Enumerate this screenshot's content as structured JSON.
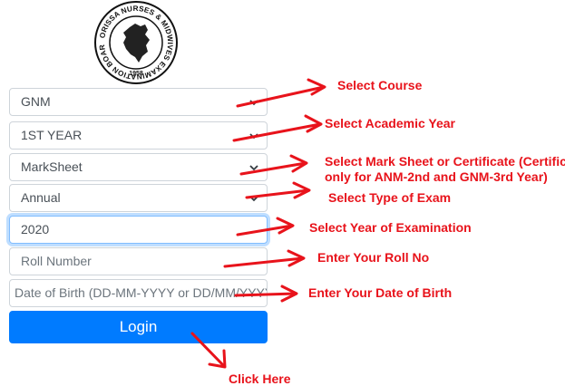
{
  "form": {
    "course": "GNM",
    "academic_year": "1ST YEAR",
    "document_type": "MarkSheet",
    "exam_type": "Annual",
    "exam_year": "2020",
    "roll_placeholder": "Roll Number",
    "dob_placeholder": "Date of Birth (DD-MM-YYYY or DD/MM/YYYY)",
    "login_label": "Login"
  },
  "logo": {
    "text_ring": "ORISSA NURSES & MIDWIVES EXAMINATION BOARD",
    "year": "1958"
  },
  "annotations": {
    "course": "Select Course",
    "academic_year": "Select Academic Year",
    "document_type_line1": "Select Mark Sheet or Certificate (Certificate",
    "document_type_line2": "only for ANM-2nd and GNM-3rd Year)",
    "exam_type": "Select Type of Exam",
    "exam_year": "Select Year of Examination",
    "roll": "Enter Your Roll No",
    "dob": "Enter Your Date of Birth",
    "login": "Click Here"
  },
  "colors": {
    "annotation_red": "#e8131b",
    "primary_blue": "#007bff",
    "border_gray": "#ced4da"
  }
}
